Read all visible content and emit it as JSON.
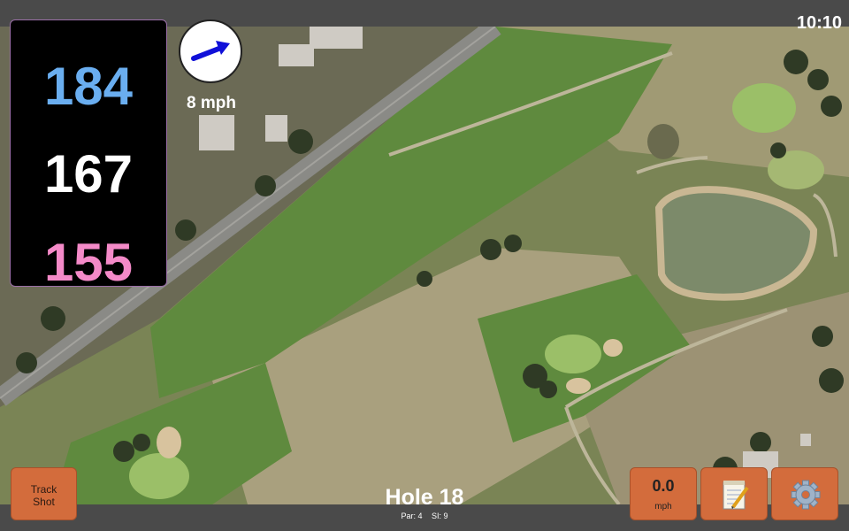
{
  "status": {
    "time": "10:10"
  },
  "distances": {
    "back": "184",
    "middle": "167",
    "front": "155"
  },
  "wind": {
    "label": "8 mph",
    "icon": "wind-direction-arrow-icon"
  },
  "buttons": {
    "track_shot_line1": "Track",
    "track_shot_line2": "Shot",
    "speed_value": "0.0",
    "speed_unit": "mph",
    "notes_icon": "notepad-icon",
    "settings_icon": "gear-icon"
  },
  "hole": {
    "title": "Hole 18",
    "par": "Par: 4",
    "si": "SI: 9"
  },
  "colors": {
    "back": "#6aaef0",
    "middle": "#ffffff",
    "front": "#f48ac8",
    "button": "#d36c3c"
  }
}
